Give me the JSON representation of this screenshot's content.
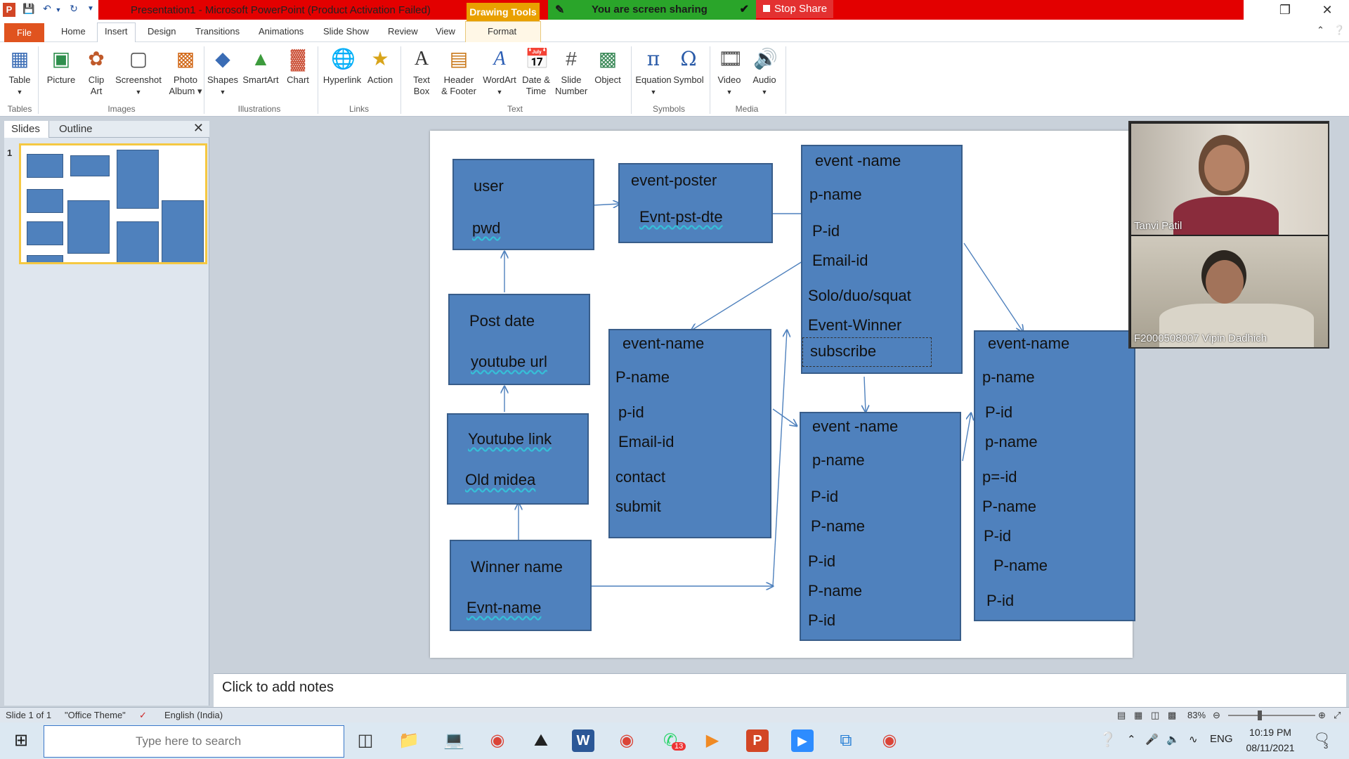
{
  "window": {
    "title": "Presentation1  -  Microsoft PowerPoint (Product Activation Failed)",
    "context_tab_group": "Drawing Tools",
    "app_icon": "P"
  },
  "screen_share": {
    "status": "You are screen sharing",
    "stop_label": "Stop Share"
  },
  "tabs": [
    "File",
    "Home",
    "Insert",
    "Design",
    "Transitions",
    "Animations",
    "Slide Show",
    "Review",
    "View",
    "Format"
  ],
  "active_tab": "Insert",
  "ribbon": {
    "groups": [
      {
        "name": "Tables",
        "buttons": [
          {
            "label": "Table",
            "icon": "table-icon"
          }
        ]
      },
      {
        "name": "Images",
        "buttons": [
          {
            "label": "Picture",
            "icon": "picture-icon"
          },
          {
            "label": "Clip Art",
            "icon": "clip-art-icon"
          },
          {
            "label": "Screenshot",
            "icon": "screenshot-icon"
          },
          {
            "label": "Photo Album",
            "icon": "photo-album-icon"
          }
        ]
      },
      {
        "name": "Illustrations",
        "buttons": [
          {
            "label": "Shapes",
            "icon": "shapes-icon"
          },
          {
            "label": "SmartArt",
            "icon": "smartart-icon"
          },
          {
            "label": "Chart",
            "icon": "chart-icon"
          }
        ]
      },
      {
        "name": "Links",
        "buttons": [
          {
            "label": "Hyperlink",
            "icon": "hyperlink-icon"
          },
          {
            "label": "Action",
            "icon": "action-icon"
          }
        ]
      },
      {
        "name": "Text",
        "buttons": [
          {
            "label": "Text Box",
            "icon": "text-box-icon"
          },
          {
            "label": "Header & Footer",
            "icon": "header-footer-icon"
          },
          {
            "label": "WordArt",
            "icon": "wordart-icon"
          },
          {
            "label": "Date & Time",
            "icon": "date-time-icon"
          },
          {
            "label": "Slide Number",
            "icon": "slide-number-icon"
          },
          {
            "label": "Object",
            "icon": "object-icon"
          }
        ]
      },
      {
        "name": "Symbols",
        "buttons": [
          {
            "label": "Equation",
            "icon": "equation-icon"
          },
          {
            "label": "Symbol",
            "icon": "symbol-icon"
          }
        ]
      },
      {
        "name": "Media",
        "buttons": [
          {
            "label": "Video",
            "icon": "video-icon"
          },
          {
            "label": "Audio",
            "icon": "audio-icon"
          }
        ]
      }
    ]
  },
  "left_pane": {
    "tabs": [
      "Slides",
      "Outline"
    ],
    "slide_number": "1"
  },
  "slide": {
    "boxes": [
      {
        "id": "user",
        "lines": [
          "user",
          "pwd"
        ]
      },
      {
        "id": "event-poster",
        "lines": [
          "event-poster",
          "Evnt-pst-dte"
        ]
      },
      {
        "id": "event-main",
        "lines": [
          "event -name",
          "p-name",
          "P-id",
          "Email-id",
          "Solo/duo/squat",
          "Event-Winner",
          "subscribe"
        ]
      },
      {
        "id": "post-date",
        "lines": [
          "Post date",
          "youtube url"
        ]
      },
      {
        "id": "event-mid",
        "lines": [
          "event-name",
          "P-name",
          "p-id",
          "Email-id",
          "contact",
          "submit"
        ]
      },
      {
        "id": "youtube-link",
        "lines": [
          "Youtube link",
          "Old midea"
        ]
      },
      {
        "id": "winner",
        "lines": [
          "Winner name",
          "Evnt-name"
        ]
      },
      {
        "id": "event-bottom",
        "lines": [
          "event -name",
          "p-name",
          "P-id",
          "P-name",
          "P-id",
          "P-name",
          "P-id"
        ]
      },
      {
        "id": "event-right",
        "lines": [
          "event-name",
          "p-name",
          "P-id",
          "p-name",
          "p=-id",
          "P-name",
          "P-id",
          "P-name",
          "P-id"
        ]
      }
    ]
  },
  "participants": [
    {
      "name": "Tanvi Patil"
    },
    {
      "name": "F2000508007 Vipin Dadhich"
    }
  ],
  "notes": {
    "placeholder": "Click to add notes"
  },
  "status_bar": {
    "slide_info": "Slide 1 of 1",
    "theme": "\"Office Theme\"",
    "language": "English (India)",
    "zoom": "83%"
  },
  "taskbar": {
    "search_placeholder": "Type here to search",
    "whatsapp_badge": "13",
    "time": "10:19 PM",
    "date": "08/11/2021",
    "lang": "ENG",
    "notif_count": "3"
  },
  "colors": {
    "box_fill": "#4f81bd",
    "box_border": "#385d8a",
    "title_bar": "#e30000",
    "share_bar": "#2aa52a",
    "stop_share": "#e33131"
  }
}
